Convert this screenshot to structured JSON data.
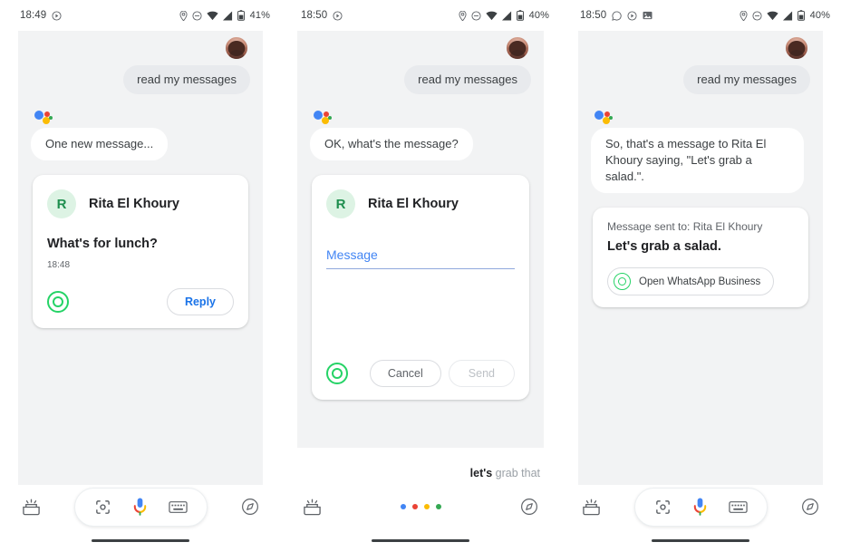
{
  "app": {
    "name": "Google Assistant",
    "platform": "Android"
  },
  "colors": {
    "accent_blue": "#4285f4",
    "link_blue": "#1a73e8",
    "whatsapp_green": "#25d366",
    "avatar_green_bg": "#ddf3e4",
    "avatar_green_fg": "#1e8e4e",
    "canvas_bg": "#f2f3f4",
    "bubble_user_bg": "#e8eaed",
    "google_red": "#ea4335",
    "google_yellow": "#fbbc04",
    "google_green": "#34a853"
  },
  "panels": [
    {
      "id": "panel-1-read-message",
      "statusbar": {
        "time": "18:49",
        "left_icons": [
          "play-badge-icon"
        ],
        "right_icons": [
          "location-icon",
          "dnd-icon",
          "wifi-icon",
          "signal-icon",
          "battery-icon"
        ],
        "battery": "41%"
      },
      "user_query": "read my messages",
      "assistant_reply": "One new message...",
      "card": {
        "type": "incoming-message",
        "avatar_initial": "R",
        "contact": "Rita El Khoury",
        "message": "What's for lunch?",
        "time": "18:48",
        "source_icon": "whatsapp-icon",
        "action_label": "Reply"
      },
      "navbar": {
        "type": "pill",
        "left_icon": "snapshot-icon",
        "pill_icons": [
          "lens-icon",
          "mic-icon",
          "keyboard-icon"
        ],
        "right_icon": "explore-icon"
      }
    },
    {
      "id": "panel-2-compose",
      "statusbar": {
        "time": "18:50",
        "left_icons": [
          "play-badge-icon"
        ],
        "right_icons": [
          "location-icon",
          "dnd-icon",
          "wifi-icon",
          "signal-icon",
          "battery-icon"
        ],
        "battery": "40%"
      },
      "user_query": "read my messages",
      "assistant_reply": "OK, what's the message?",
      "card": {
        "type": "compose-message",
        "avatar_initial": "R",
        "contact": "Rita El Khoury",
        "input_placeholder": "Message",
        "input_value": "",
        "source_icon": "whatsapp-icon",
        "cancel_label": "Cancel",
        "send_label": "Send",
        "send_disabled": true
      },
      "transcript": {
        "final": "let's",
        "partial": "grab that"
      },
      "navbar": {
        "type": "listening-dots",
        "left_icon": "snapshot-icon",
        "right_icon": "explore-icon"
      }
    },
    {
      "id": "panel-3-sent",
      "statusbar": {
        "time": "18:50",
        "left_icons": [
          "whatsapp-icon",
          "play-badge-icon",
          "image-icon"
        ],
        "right_icons": [
          "location-icon",
          "dnd-icon",
          "wifi-icon",
          "signal-icon",
          "battery-icon"
        ],
        "battery": "40%"
      },
      "user_query": "read my messages",
      "assistant_reply": "So, that's a message to Rita El Khoury saying, \"Let's grab a salad.\".",
      "card": {
        "type": "message-sent",
        "sent_to_label": "Message sent to: Rita El Khoury",
        "message": "Let's grab a salad.",
        "chip_icon": "whatsapp-icon",
        "chip_label": "Open WhatsApp Business"
      },
      "navbar": {
        "type": "pill",
        "left_icon": "snapshot-icon",
        "pill_icons": [
          "lens-icon",
          "mic-icon",
          "keyboard-icon"
        ],
        "right_icon": "explore-icon"
      }
    }
  ]
}
